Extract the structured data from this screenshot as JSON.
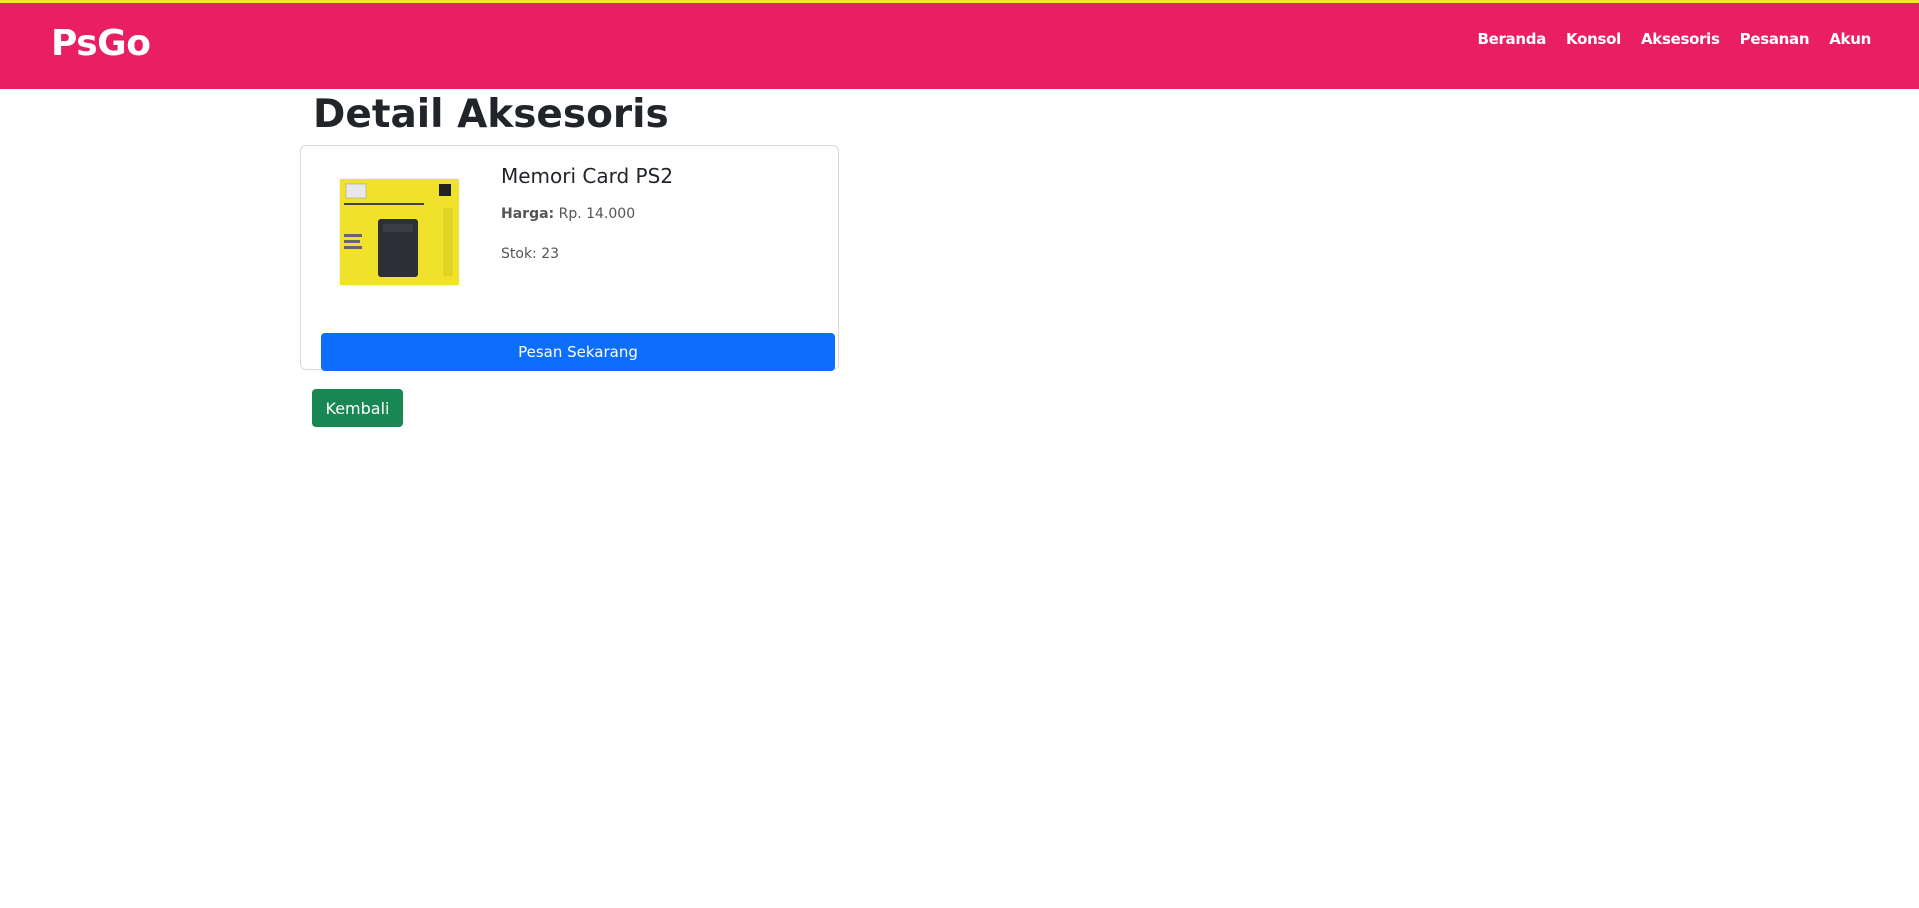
{
  "colors": {
    "navbar_bg": "#e91e63",
    "primary_button": "#0d6efd",
    "back_button": "#198754"
  },
  "navbar": {
    "brand": "PsGo",
    "links": [
      "Beranda",
      "Konsol",
      "Aksesoris",
      "Pesanan",
      "Akun"
    ]
  },
  "page": {
    "title": "Detail Aksesoris"
  },
  "product": {
    "name": "Memori Card PS2",
    "price_label": "Harga:",
    "price_value": "Rp. 14.000",
    "stock_text": "Stok: 23",
    "order_button": "Pesan Sekarang"
  },
  "actions": {
    "back_button": "Kembali"
  }
}
